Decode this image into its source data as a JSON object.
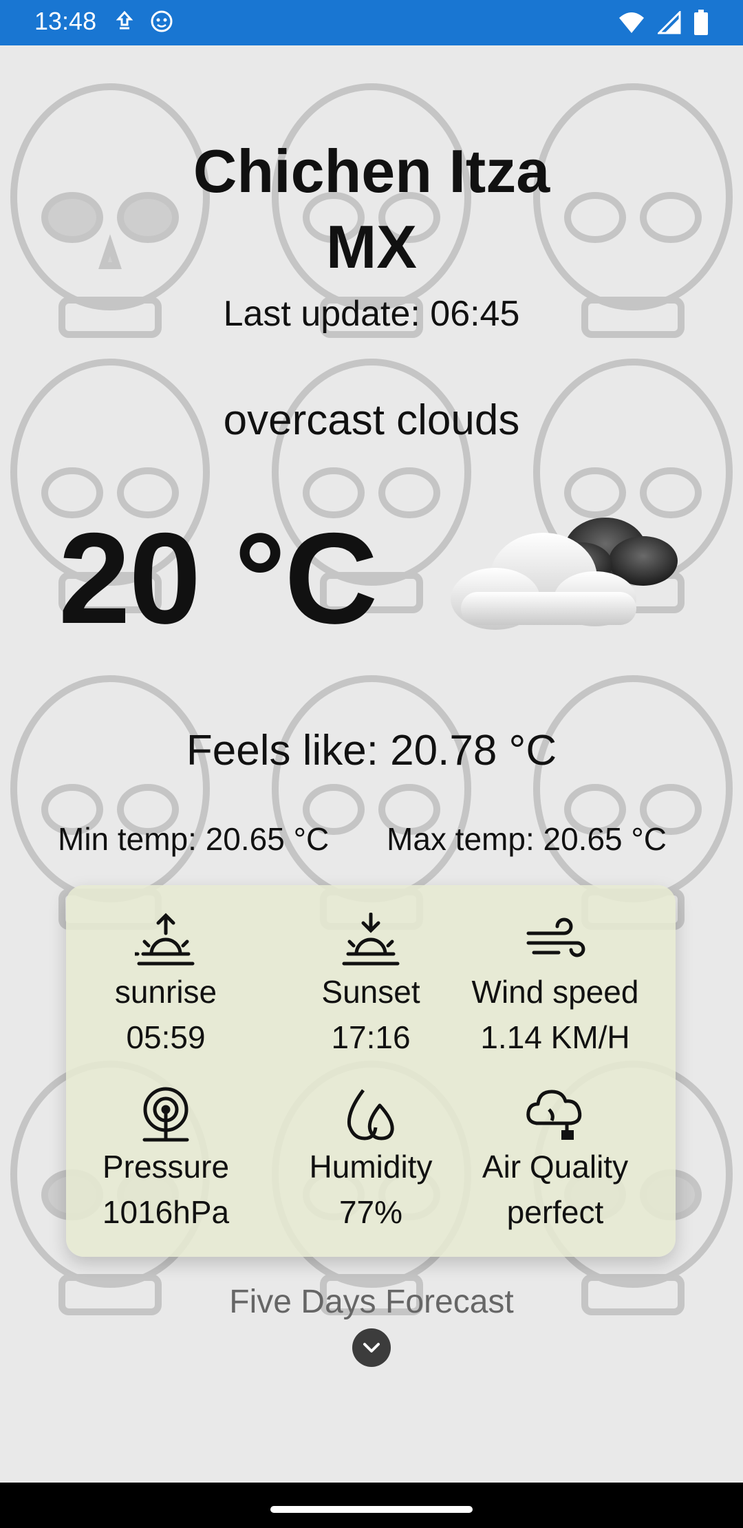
{
  "status_bar": {
    "time": "13:48",
    "icons_left": [
      "download-icon",
      "face-icon"
    ],
    "icons_right": [
      "wifi-icon",
      "signal-icon",
      "battery-icon"
    ]
  },
  "location": {
    "city": "Chichen Itza",
    "country": "MX"
  },
  "last_update": "Last update: 06:45",
  "description": "overcast clouds",
  "temperature": "20 °C",
  "weather_icon": "cloudy-icon",
  "feels_like": "Feels like: 20.78 °C",
  "min_temp": "Min temp: 20.65 °C",
  "max_temp": "Max temp: 20.65 °C",
  "details": {
    "sunrise": {
      "label": "sunrise",
      "value": "05:59",
      "icon": "sunrise-icon"
    },
    "sunset": {
      "label": "Sunset",
      "value": "17:16",
      "icon": "sunset-icon"
    },
    "wind": {
      "label": "Wind speed",
      "value": "1.14 KM/H",
      "icon": "wind-icon"
    },
    "pressure": {
      "label": "Pressure",
      "value": "1016hPa",
      "icon": "pressure-icon"
    },
    "humidity": {
      "label": "Humidity",
      "value": "77%",
      "icon": "humidity-icon"
    },
    "air_quality": {
      "label": "Air Quality",
      "value": "perfect",
      "icon": "air-quality-icon"
    }
  },
  "forecast": {
    "title": "Five Days Forecast",
    "expand_icon": "chevron-down-icon"
  },
  "colors": {
    "status_bar": "#1976d2",
    "card": "#e6e9d2",
    "text": "#111111",
    "muted": "#666666"
  }
}
